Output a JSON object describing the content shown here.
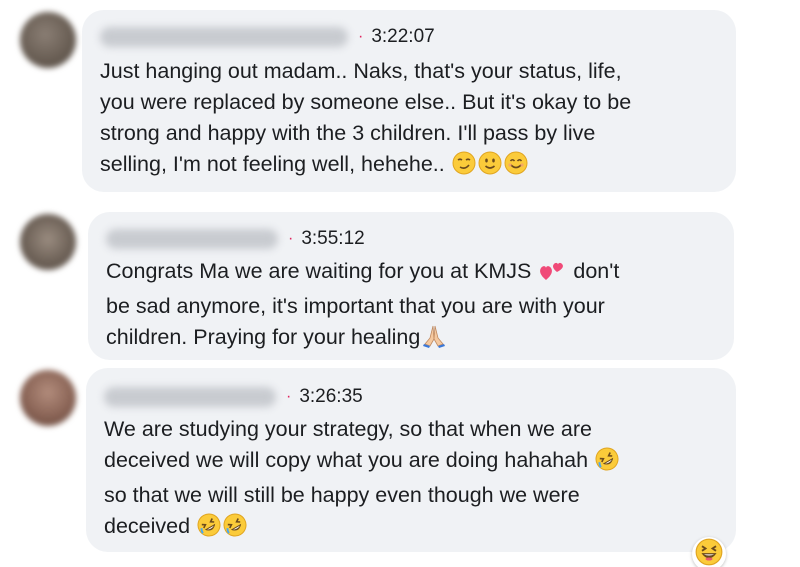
{
  "comments": [
    {
      "time": "3:22:07",
      "lines": [
        "Just hanging out madam.. Naks, that's your status, life,",
        "you were replaced by someone else.. But it's okay to be",
        "strong and happy with the 3 children. I'll pass by live",
        "selling, I'm not feeling well, hehehe.."
      ],
      "emojis": [
        "smirk-face-icon",
        "slight-smile-face-icon",
        "smiling-eyes-face-icon"
      ]
    },
    {
      "time": "3:55:12",
      "line1_a": "Congrats Ma we are waiting for you at KMJS",
      "line1_b": "don't",
      "lines": [
        "be sad anymore, it's important that you are with your",
        "children. Praying for your healing"
      ],
      "emojis": [
        "two-hearts-icon",
        "praying-hands-icon"
      ]
    },
    {
      "time": "3:26:35",
      "lines": [
        "We are studying your strategy, so that when we are",
        "deceived we will copy what you are doing hahahah",
        "so that we will still be happy even though we were",
        "deceived"
      ],
      "emojis": [
        "rofl-face-icon",
        "rofl-face-icon",
        "rofl-face-icon"
      ]
    }
  ],
  "reaction": {
    "icon": "laughing-face-icon"
  },
  "colors": {
    "bubble": "#f0f2f5",
    "text": "#1c1e21",
    "dot": "#e0245e",
    "emoji_yellow": "#fbcb3a"
  }
}
